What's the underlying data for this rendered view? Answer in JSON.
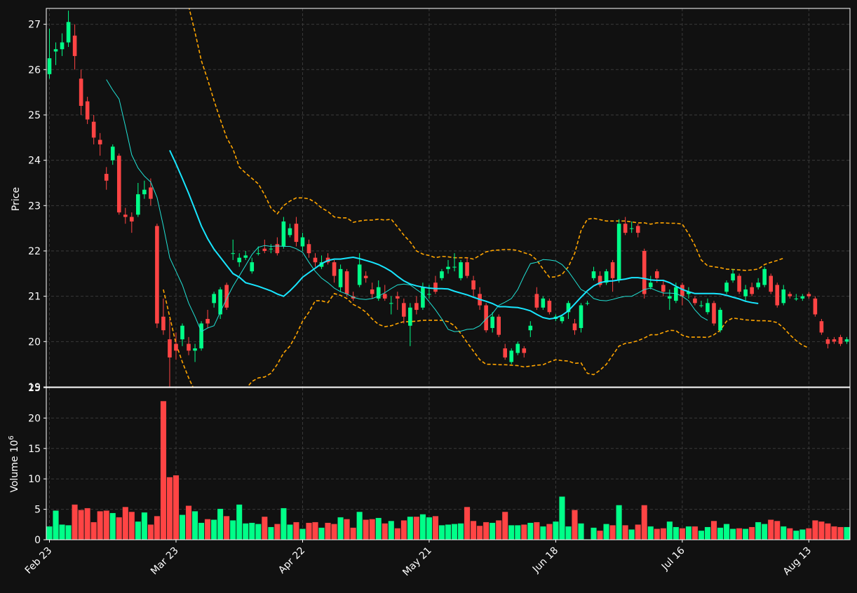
{
  "chart_data": {
    "type": "candlestick",
    "grid": true,
    "colors": {
      "background": "#111111",
      "up": "#00ff88",
      "down": "#ff4444",
      "ma_fast": "#21e1d4",
      "ma_slow": "#18e6ff",
      "bands": "#ffa500",
      "grid": "#3a3a3a",
      "text": "#ffffff"
    },
    "price_panel": {
      "ylabel": "Price",
      "ylim": [
        19,
        27.35
      ],
      "yticks": [
        19,
        20,
        21,
        22,
        23,
        24,
        25,
        26,
        27
      ]
    },
    "volume_panel": {
      "ylabel": "Volume",
      "ylabel_exp": "6",
      "ylim": [
        0,
        25
      ],
      "yticks": [
        0,
        5,
        10,
        15,
        20,
        25
      ]
    },
    "x_ticks": [
      {
        "i": 0,
        "label": "Feb 23"
      },
      {
        "i": 20,
        "label": "Mar 23"
      },
      {
        "i": 40,
        "label": "Apr 22"
      },
      {
        "i": 60,
        "label": "May 21"
      },
      {
        "i": 80,
        "label": "Jun 18"
      },
      {
        "i": 100,
        "label": "Jul 16"
      },
      {
        "i": 120,
        "label": "Aug 13"
      }
    ],
    "candles": [
      [
        25.9,
        26.25,
        26.9,
        25.8,
        2.2
      ],
      [
        26.4,
        26.45,
        26.6,
        26.1,
        4.8
      ],
      [
        26.45,
        26.6,
        26.8,
        26.3,
        2.5
      ],
      [
        26.6,
        27.05,
        27.3,
        26.5,
        2.4
      ],
      [
        26.75,
        26.3,
        27.0,
        26.0,
        5.8
      ],
      [
        25.8,
        25.2,
        26.0,
        25.0,
        4.9
      ],
      [
        25.3,
        24.9,
        25.4,
        24.8,
        5.2
      ],
      [
        24.85,
        24.5,
        25.0,
        24.35,
        2.9
      ],
      [
        24.45,
        24.35,
        24.6,
        24.1,
        4.7
      ],
      [
        23.7,
        23.55,
        23.85,
        23.35,
        4.8
      ],
      [
        24.0,
        24.3,
        24.35,
        23.9,
        4.4
      ],
      [
        24.1,
        22.85,
        24.15,
        22.8,
        3.7
      ],
      [
        22.8,
        22.75,
        22.95,
        22.6,
        5.4
      ],
      [
        22.75,
        22.65,
        22.85,
        22.4,
        4.6
      ],
      [
        22.8,
        23.25,
        23.5,
        22.75,
        3.0
      ],
      [
        23.25,
        23.35,
        23.55,
        23.15,
        4.5
      ],
      [
        23.4,
        23.15,
        23.6,
        23.0,
        2.5
      ],
      [
        22.55,
        20.4,
        22.6,
        20.3,
        3.9
      ],
      [
        20.55,
        20.25,
        20.95,
        20.15,
        22.8
      ],
      [
        20.05,
        19.65,
        20.5,
        19.0,
        10.3
      ],
      [
        19.95,
        19.8,
        20.2,
        19.6,
        10.6
      ],
      [
        20.05,
        20.35,
        20.4,
        19.9,
        4.1
      ],
      [
        19.95,
        19.8,
        20.1,
        19.7,
        5.6
      ],
      [
        19.8,
        19.85,
        19.95,
        19.55,
        4.7
      ],
      [
        19.85,
        20.4,
        20.45,
        19.8,
        2.8
      ],
      [
        20.5,
        20.4,
        20.7,
        20.3,
        3.4
      ],
      [
        20.85,
        21.05,
        21.1,
        20.75,
        3.3
      ],
      [
        20.6,
        21.15,
        21.2,
        20.5,
        5.1
      ],
      [
        21.25,
        20.75,
        21.3,
        20.7,
        3.9
      ],
      [
        21.95,
        21.95,
        22.25,
        21.8,
        3.2
      ],
      [
        21.75,
        21.85,
        21.95,
        21.65,
        5.8
      ],
      [
        21.85,
        21.9,
        22.0,
        21.8,
        2.7
      ],
      [
        21.55,
        21.75,
        21.85,
        21.5,
        2.8
      ],
      [
        21.95,
        21.95,
        22.1,
        21.9,
        2.6
      ],
      [
        22.05,
        22.0,
        22.25,
        21.95,
        3.8
      ],
      [
        22.05,
        22.05,
        22.15,
        21.95,
        2.1
      ],
      [
        22.15,
        21.95,
        22.3,
        21.9,
        2.6
      ],
      [
        22.1,
        22.65,
        22.75,
        22.05,
        5.2
      ],
      [
        22.35,
        22.5,
        22.6,
        22.3,
        2.5
      ],
      [
        22.6,
        22.2,
        22.75,
        22.1,
        2.9
      ],
      [
        22.1,
        22.3,
        22.4,
        22.0,
        1.8
      ],
      [
        22.15,
        21.95,
        22.25,
        21.85,
        2.8
      ],
      [
        21.85,
        21.75,
        21.95,
        21.65,
        2.9
      ],
      [
        21.65,
        21.75,
        21.9,
        21.6,
        2.0
      ],
      [
        21.85,
        21.75,
        21.95,
        21.7,
        2.8
      ],
      [
        21.75,
        21.45,
        21.8,
        21.3,
        2.6
      ],
      [
        21.2,
        21.6,
        21.7,
        21.1,
        3.7
      ],
      [
        21.55,
        21.05,
        21.6,
        21.0,
        3.4
      ],
      [
        21.0,
        20.95,
        21.1,
        20.9,
        2.0
      ],
      [
        21.25,
        21.7,
        21.95,
        21.2,
        4.6
      ],
      [
        21.45,
        21.4,
        21.55,
        21.3,
        3.3
      ],
      [
        21.15,
        21.05,
        21.3,
        20.95,
        3.4
      ],
      [
        20.95,
        21.2,
        21.35,
        20.9,
        3.6
      ],
      [
        21.05,
        20.95,
        21.25,
        20.9,
        2.7
      ],
      [
        20.85,
        20.85,
        21.0,
        20.6,
        3.1
      ],
      [
        21.0,
        20.95,
        21.1,
        20.7,
        1.9
      ],
      [
        20.85,
        20.55,
        20.95,
        20.4,
        3.2
      ],
      [
        20.35,
        20.75,
        20.85,
        19.9,
        3.8
      ],
      [
        20.85,
        20.7,
        21.0,
        20.6,
        3.8
      ],
      [
        20.75,
        21.2,
        21.3,
        20.7,
        4.2
      ],
      [
        21.05,
        21.05,
        21.25,
        20.95,
        3.7
      ],
      [
        21.3,
        21.1,
        21.45,
        21.05,
        3.9
      ],
      [
        21.4,
        21.55,
        21.6,
        21.35,
        2.4
      ],
      [
        21.6,
        21.65,
        21.8,
        21.5,
        2.5
      ],
      [
        21.65,
        21.65,
        21.95,
        21.55,
        2.6
      ],
      [
        21.4,
        21.75,
        21.8,
        21.35,
        2.7
      ],
      [
        21.75,
        21.45,
        21.85,
        21.4,
        5.4
      ],
      [
        21.35,
        21.15,
        21.45,
        21.0,
        3.1
      ],
      [
        21.05,
        20.8,
        21.2,
        20.7,
        2.3
      ],
      [
        20.8,
        20.25,
        20.85,
        20.2,
        2.9
      ],
      [
        20.3,
        20.55,
        20.65,
        20.2,
        2.8
      ],
      [
        20.55,
        20.15,
        20.6,
        20.1,
        3.2
      ],
      [
        19.85,
        19.65,
        19.95,
        19.6,
        4.6
      ],
      [
        19.55,
        19.8,
        19.85,
        19.5,
        2.4
      ],
      [
        19.75,
        19.95,
        20.0,
        19.7,
        2.4
      ],
      [
        19.85,
        19.75,
        19.9,
        19.65,
        2.5
      ],
      [
        20.25,
        20.35,
        20.45,
        20.1,
        2.8
      ],
      [
        21.05,
        20.75,
        21.2,
        20.7,
        2.9
      ],
      [
        20.75,
        20.95,
        21.0,
        20.7,
        2.2
      ],
      [
        20.9,
        20.65,
        20.95,
        20.6,
        2.6
      ],
      [
        20.5,
        20.55,
        20.6,
        20.45,
        3.0
      ],
      [
        20.45,
        20.55,
        20.6,
        20.4,
        7.1
      ],
      [
        20.65,
        20.85,
        20.9,
        20.5,
        2.2
      ],
      [
        20.4,
        20.25,
        20.5,
        20.15,
        4.9
      ],
      [
        20.3,
        20.8,
        20.85,
        20.2,
        2.7
      ],
      [
        20.85,
        20.85,
        20.9,
        20.8,
        0.1
      ],
      [
        21.4,
        21.55,
        21.65,
        21.35,
        2.0
      ],
      [
        21.45,
        21.25,
        21.55,
        21.2,
        1.5
      ],
      [
        21.3,
        21.55,
        21.6,
        21.25,
        2.6
      ],
      [
        21.75,
        21.4,
        21.8,
        21.1,
        2.4
      ],
      [
        21.35,
        22.6,
        22.7,
        21.3,
        5.7
      ],
      [
        22.6,
        22.4,
        22.75,
        22.35,
        2.4
      ],
      [
        22.5,
        22.5,
        22.65,
        22.4,
        1.7
      ],
      [
        22.55,
        22.4,
        22.6,
        22.3,
        2.5
      ],
      [
        22.0,
        21.05,
        22.05,
        20.95,
        5.7
      ],
      [
        21.2,
        21.3,
        21.45,
        21.15,
        2.2
      ],
      [
        21.55,
        21.4,
        21.6,
        21.3,
        1.8
      ],
      [
        21.25,
        21.1,
        21.35,
        21.0,
        1.9
      ],
      [
        20.95,
        21.0,
        21.15,
        20.7,
        3.0
      ],
      [
        20.9,
        21.2,
        21.3,
        20.85,
        2.1
      ],
      [
        21.25,
        21.0,
        21.3,
        20.8,
        1.9
      ],
      [
        21.05,
        21.1,
        21.2,
        20.95,
        2.2
      ],
      [
        20.95,
        20.85,
        21.0,
        20.8,
        2.2
      ],
      [
        20.8,
        20.8,
        20.9,
        20.75,
        1.5
      ],
      [
        20.65,
        20.85,
        20.95,
        20.6,
        2.1
      ],
      [
        20.85,
        20.4,
        20.9,
        20.35,
        3.1
      ],
      [
        20.25,
        20.7,
        20.75,
        20.2,
        2.0
      ],
      [
        21.1,
        21.3,
        21.35,
        21.05,
        2.6
      ],
      [
        21.35,
        21.5,
        21.6,
        21.3,
        1.8
      ],
      [
        21.45,
        21.1,
        21.5,
        21.05,
        1.9
      ],
      [
        21.0,
        21.15,
        21.25,
        20.9,
        1.8
      ],
      [
        21.2,
        21.05,
        21.3,
        21.0,
        2.1
      ],
      [
        21.2,
        21.3,
        21.4,
        21.15,
        2.9
      ],
      [
        21.25,
        21.6,
        21.65,
        21.2,
        2.6
      ],
      [
        21.45,
        21.1,
        21.5,
        21.05,
        3.3
      ],
      [
        21.25,
        20.8,
        21.3,
        20.75,
        3.1
      ],
      [
        20.85,
        21.15,
        21.25,
        20.8,
        2.2
      ],
      [
        21.05,
        21.0,
        21.1,
        20.95,
        1.9
      ],
      [
        20.95,
        20.95,
        21.05,
        20.9,
        1.5
      ],
      [
        20.95,
        21.0,
        21.05,
        20.9,
        1.7
      ],
      [
        21.05,
        21.0,
        21.1,
        20.95,
        1.9
      ],
      [
        20.95,
        20.6,
        21.0,
        20.55,
        3.2
      ],
      [
        20.45,
        20.2,
        20.5,
        20.15,
        3.0
      ],
      [
        20.05,
        19.95,
        20.1,
        19.85,
        2.7
      ],
      [
        20.05,
        20.0,
        20.1,
        19.95,
        2.2
      ],
      [
        20.1,
        19.95,
        20.15,
        19.9,
        2.1
      ],
      [
        20.0,
        20.05,
        20.1,
        19.95,
        2.1
      ]
    ],
    "ma_fast": {
      "start": 9,
      "values": [
        25.78,
        25.55,
        25.35,
        24.75,
        24.12,
        23.83,
        23.65,
        23.52,
        23.18,
        22.55,
        21.85,
        21.55,
        21.25,
        20.85,
        20.55,
        20.22,
        20.3,
        20.35,
        20.65,
        20.95,
        21.22,
        21.45,
        21.68,
        21.92,
        22.08,
        22.12,
        22.1,
        22.11,
        22.1,
        22.1,
        22.05,
        21.97,
        21.75,
        21.55,
        21.4,
        21.3,
        21.18,
        21.1,
        21.05,
        20.98,
        20.94,
        20.93,
        20.95,
        21.0,
        21.08,
        21.17,
        21.25,
        21.27,
        21.25,
        21.15,
        21.05,
        20.88,
        20.7,
        20.5,
        20.27,
        20.22,
        20.23,
        20.27,
        20.28,
        20.35,
        20.5,
        20.62,
        20.8,
        20.87,
        20.95,
        21.15,
        21.45,
        21.72,
        21.75,
        21.81,
        21.8,
        21.78,
        21.7,
        21.55,
        21.35,
        21.15,
        21.08,
        20.95,
        20.91,
        20.9,
        20.93,
        20.97,
        21.0,
        21.0,
        21.07,
        21.15,
        21.18,
        21.12,
        21.07,
        21.07,
        21.06,
        21.0,
        20.9,
        20.7,
        20.55,
        20.47
      ]
    },
    "ma_slow": {
      "start": 19,
      "values": [
        24.22,
        23.92,
        23.6,
        23.27,
        22.91,
        22.55,
        22.27,
        22.04,
        21.86,
        21.68,
        21.5,
        21.42,
        21.3,
        21.26,
        21.22,
        21.17,
        21.12,
        21.05,
        21.0,
        21.12,
        21.26,
        21.42,
        21.52,
        21.62,
        21.72,
        21.79,
        21.82,
        21.82,
        21.84,
        21.86,
        21.83,
        21.79,
        21.75,
        21.7,
        21.63,
        21.55,
        21.44,
        21.34,
        21.27,
        21.23,
        21.2,
        21.18,
        21.17,
        21.17,
        21.16,
        21.11,
        21.07,
        21.03,
        20.98,
        20.93,
        20.89,
        20.84,
        20.77,
        20.77,
        20.76,
        20.75,
        20.72,
        20.68,
        20.6,
        20.53,
        20.5,
        20.52,
        20.58,
        20.68,
        20.83,
        20.98,
        21.12,
        21.23,
        21.3,
        21.33,
        21.34,
        21.36,
        21.38,
        21.41,
        21.41,
        21.39,
        21.36,
        21.35,
        21.35,
        21.3,
        21.22,
        21.15,
        21.1,
        21.06,
        21.06,
        21.06,
        21.06,
        21.05,
        21.02,
        20.98,
        20.94,
        20.89,
        20.86,
        20.84
      ]
    },
    "band_upper": {
      "start": 22,
      "values": [
        27.4,
        26.82,
        26.2,
        25.78,
        25.32,
        24.9,
        24.5,
        24.25,
        23.85,
        23.72,
        23.6,
        23.48,
        23.24,
        22.95,
        22.82,
        23.0,
        23.1,
        23.17,
        23.17,
        23.15,
        23.07,
        22.95,
        22.87,
        22.75,
        22.73,
        22.73,
        22.63,
        22.66,
        22.68,
        22.68,
        22.7,
        22.68,
        22.7,
        22.53,
        22.35,
        22.2,
        22.0,
        21.93,
        21.9,
        21.85,
        21.88,
        21.87,
        21.85,
        21.85,
        21.85,
        21.82,
        21.9,
        21.98,
        22.01,
        22.02,
        22.03,
        22.03,
        22.01,
        21.96,
        21.92,
        21.8,
        21.6,
        21.42,
        21.43,
        21.48,
        21.65,
        21.95,
        22.45,
        22.7,
        22.72,
        22.69,
        22.66,
        22.66,
        22.66,
        22.66,
        22.64,
        22.62,
        22.62,
        22.59,
        22.62,
        22.62,
        22.61,
        22.61,
        22.59,
        22.38,
        22.12,
        21.8,
        21.67,
        21.65,
        21.63,
        21.6,
        21.59,
        21.58,
        21.57,
        21.58,
        21.6,
        21.7,
        21.75,
        21.79,
        21.84
      ]
    },
    "band_lower": {
      "start": 18,
      "values": [
        21.15,
        20.55,
        19.95,
        19.55,
        19.2,
        18.9,
        18.65,
        18.45,
        18.3,
        18.2,
        18.3,
        18.55,
        18.7,
        18.95,
        19.12,
        19.2,
        19.22,
        19.3,
        19.5,
        19.75,
        19.9,
        20.15,
        20.45,
        20.65,
        20.9,
        20.9,
        20.86,
        21.06,
        21.02,
        20.95,
        20.82,
        20.75,
        20.65,
        20.5,
        20.38,
        20.33,
        20.35,
        20.4,
        20.44,
        20.44,
        20.45,
        20.47,
        20.47,
        20.47,
        20.47,
        20.44,
        20.35,
        20.18,
        19.98,
        19.79,
        19.6,
        19.5,
        19.5,
        19.49,
        19.49,
        19.48,
        19.47,
        19.44,
        19.46,
        19.48,
        19.49,
        19.55,
        19.6,
        19.58,
        19.57,
        19.52,
        19.53,
        19.3,
        19.27,
        19.37,
        19.5,
        19.7,
        19.9,
        19.96,
        19.98,
        20.02,
        20.08,
        20.15,
        20.15,
        20.2,
        20.25,
        20.24,
        20.14,
        20.1,
        20.1,
        20.1,
        20.09,
        20.15,
        20.25,
        20.45,
        20.52,
        20.5,
        20.48,
        20.47,
        20.46,
        20.46,
        20.45,
        20.42,
        20.3,
        20.15,
        20.02,
        19.92,
        19.86
      ]
    }
  }
}
